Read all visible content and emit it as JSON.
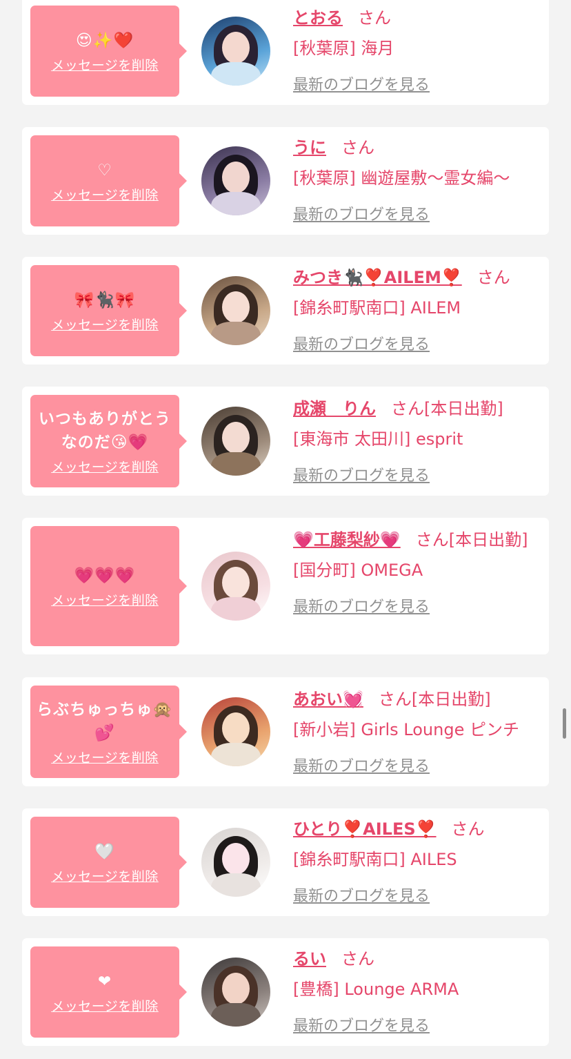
{
  "labels": {
    "san": "さん",
    "delete": "メッセージを削除",
    "blog": "最新のブログを見る"
  },
  "cards": [
    {
      "message": "😍✨❤️",
      "name": "とおる",
      "extra": "",
      "shop": "[秋葉原] 海月"
    },
    {
      "message": "♡",
      "name": "うに",
      "extra": "",
      "shop": "[秋葉原] 幽遊屋敷〜霊女編〜"
    },
    {
      "message": "🎀🐈‍⬛🎀",
      "name": "みつき🐈‍⬛❣️AILEM❣️",
      "extra": "",
      "shop": "[錦糸町駅南口] AILEM"
    },
    {
      "message": "いつもありがとうなのだ😘💗",
      "name": "成瀬　りん",
      "extra": "[本日出勤]",
      "shop": "[東海市 太田川] esprit"
    },
    {
      "message": "💗💗💗",
      "name": "💗工藤梨紗💗",
      "extra": "[本日出勤]",
      "shop": "[国分町] OMEGA"
    },
    {
      "message": "らぶちゅっちゅ🙊💕",
      "name": "あおい💓",
      "extra": "[本日出勤]",
      "shop": "[新小岩] Girls Lounge ピンチ"
    },
    {
      "message": "🤍",
      "name": "ひとり❣️AILES❣️",
      "extra": "",
      "shop": "[錦糸町駅南口] AILES"
    },
    {
      "message": "❤",
      "name": "るい",
      "extra": "",
      "shop": "[豊橋] Lounge ARMA"
    }
  ]
}
